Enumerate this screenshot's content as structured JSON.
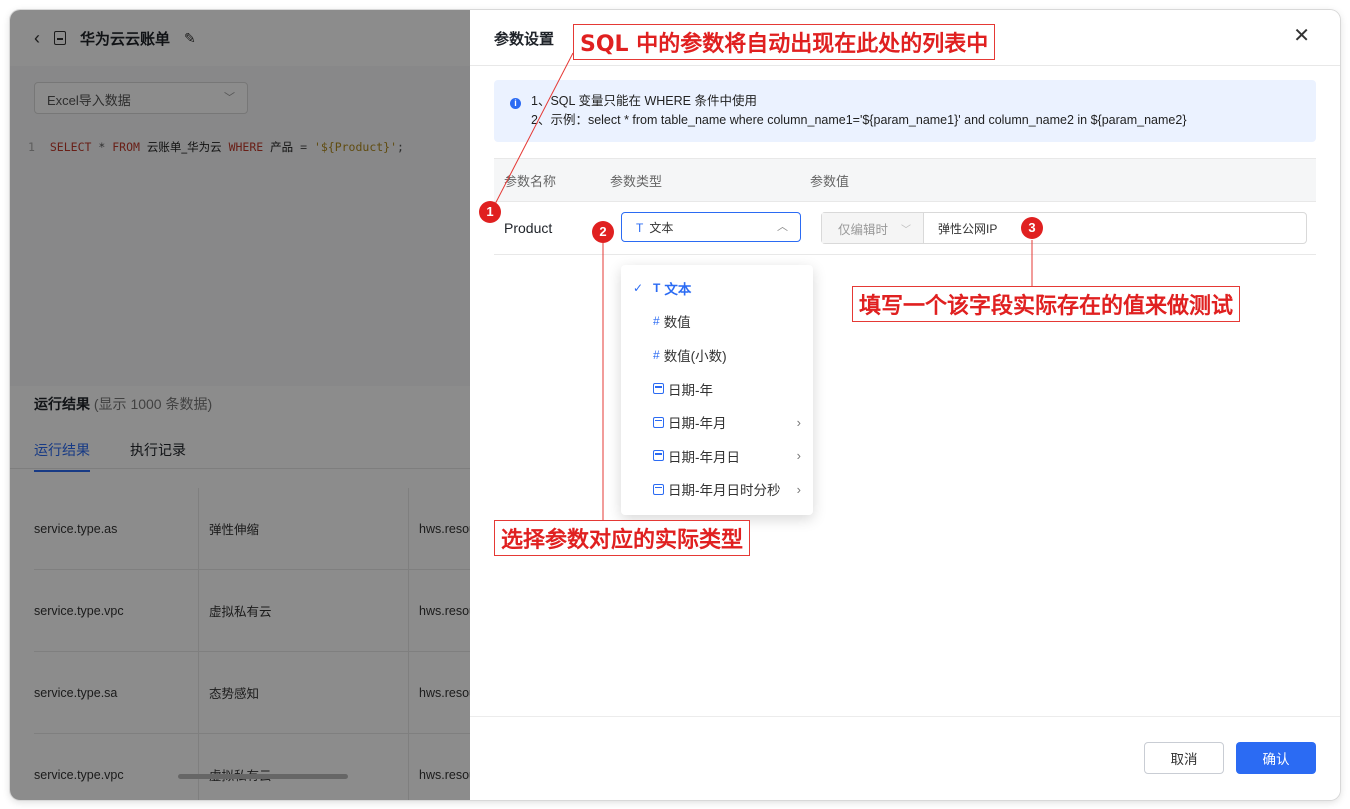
{
  "page": {
    "back_icon": "chevron-left-icon",
    "title": "华为云云账单",
    "edit_icon": "pencil-icon",
    "source_select": "Excel导入数据",
    "sql": {
      "line_no": "1",
      "select": "SELECT",
      "star": "*",
      "from": "FROM",
      "table": "云账单_华为云",
      "where": "WHERE",
      "column": "产品",
      "eq": "=",
      "value": "'${Product}'",
      "end": ";"
    },
    "results_title": "运行结果",
    "results_sub": "(显示 1000 条数据)",
    "tabs": [
      "运行结果",
      "执行记录"
    ],
    "rows": [
      [
        "service.type.as",
        "弹性伸缩",
        "hws.resour"
      ],
      [
        "service.type.vpc",
        "虚拟私有云",
        "hws.resour"
      ],
      [
        "service.type.sa",
        "态势感知",
        "hws.resour"
      ],
      [
        "service.type.vpc",
        "虚拟私有云",
        "hws.resour"
      ]
    ]
  },
  "drawer": {
    "title": "参数设置",
    "close_icon": "close-icon",
    "info": {
      "line1": "1、SQL 变量只能在 WHERE 条件中使用",
      "line2": "2、示例：select * from table_name where column_name1='${param_name1}' and column_name2 in ${param_name2}"
    },
    "headers": [
      "参数名称",
      "参数类型",
      "参数值"
    ],
    "param": {
      "name": "Product",
      "type": "文本",
      "value_mode": "仅编辑时",
      "value": "弹性公网IP"
    },
    "dropdown": [
      {
        "label": "文本",
        "icon": "T",
        "selected": true,
        "submenu": false
      },
      {
        "label": "数值",
        "icon": "#",
        "selected": false,
        "submenu": false
      },
      {
        "label": "数值(小数)",
        "icon": "#",
        "selected": false,
        "submenu": false
      },
      {
        "label": "日期-年",
        "icon": "calendar",
        "selected": false,
        "submenu": false
      },
      {
        "label": "日期-年月",
        "icon": "calendar",
        "selected": false,
        "submenu": true
      },
      {
        "label": "日期-年月日",
        "icon": "calendar",
        "selected": false,
        "submenu": true
      },
      {
        "label": "日期-年月日时分秒",
        "icon": "calendar",
        "selected": false,
        "submenu": true
      }
    ],
    "cancel": "取消",
    "confirm": "确认"
  },
  "annotations": {
    "note1": "SQL 中的参数将自动出现在此处的列表中",
    "note2": "选择参数对应的实际类型",
    "note3": "填写一个该字段实际存在的值来做测试",
    "marker1": "1",
    "marker2": "2",
    "marker3": "3",
    "color": "#e02020"
  },
  "colors": {
    "accent": "#2b6bf3",
    "info_bg": "#ebf2ff"
  }
}
